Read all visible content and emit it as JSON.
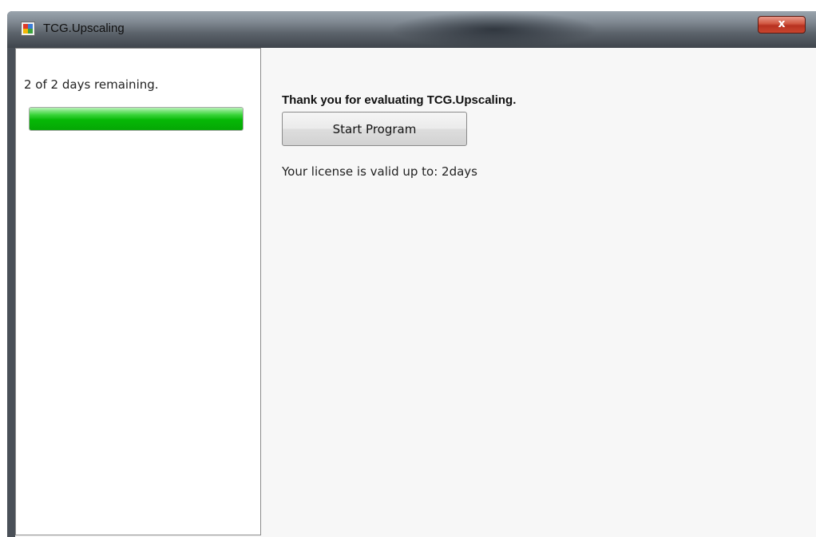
{
  "window": {
    "title": "TCG.Upscaling",
    "close_label": "x"
  },
  "trial": {
    "days_remaining_text": "2 of 2 days remaining.",
    "progress_fraction": 1.0
  },
  "main": {
    "thanks_text": "Thank you for evaluating TCG.Upscaling.",
    "start_button_label": "Start Program",
    "license_text": "Your license is valid up to: 2days"
  },
  "icons": {
    "app": "app-icon",
    "close": "close-icon"
  },
  "colors": {
    "progress_green": "#06b806",
    "close_red": "#c9452f"
  }
}
